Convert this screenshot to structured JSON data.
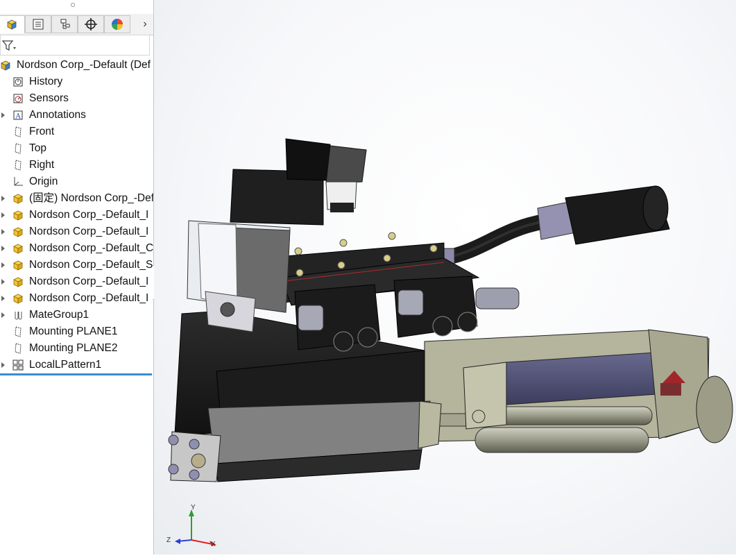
{
  "feature_tree": {
    "tabs": [
      {
        "icon": "featuremanager-icon"
      },
      {
        "icon": "propertymanager-icon"
      },
      {
        "icon": "configurationmanager-icon"
      },
      {
        "icon": "dimxpert-icon"
      },
      {
        "icon": "display-manager-icon"
      }
    ],
    "items": [
      {
        "label": "Nordson Corp_-Default (Def",
        "icon": "assembly-icon",
        "arrow": false
      },
      {
        "label": "History",
        "icon": "history-icon",
        "arrow": false
      },
      {
        "label": "Sensors",
        "icon": "sensors-icon",
        "arrow": false
      },
      {
        "label": "Annotations",
        "icon": "annotations-icon",
        "arrow": true
      },
      {
        "label": "Front",
        "icon": "plane-icon",
        "arrow": false
      },
      {
        "label": "Top",
        "icon": "plane-icon",
        "arrow": false
      },
      {
        "label": "Right",
        "icon": "plane-icon",
        "arrow": false
      },
      {
        "label": "Origin",
        "icon": "origin-icon",
        "arrow": false
      },
      {
        "label": "(固定) Nordson Corp_-Def",
        "icon": "part-icon",
        "arrow": true
      },
      {
        "label": "Nordson Corp_-Default_I",
        "icon": "part-icon",
        "arrow": true
      },
      {
        "label": "Nordson Corp_-Default_I",
        "icon": "part-icon",
        "arrow": true
      },
      {
        "label": "Nordson Corp_-Default_C",
        "icon": "part-icon",
        "arrow": true
      },
      {
        "label": "Nordson Corp_-Default_S",
        "icon": "part-icon",
        "arrow": true
      },
      {
        "label": "Nordson Corp_-Default_I",
        "icon": "part-icon",
        "arrow": true
      },
      {
        "label": "Nordson Corp_-Default_I",
        "icon": "part-icon",
        "arrow": true
      },
      {
        "label": "MateGroup1",
        "icon": "mates-icon",
        "arrow": true
      },
      {
        "label": "Mounting PLANE1",
        "icon": "plane-icon",
        "arrow": false
      },
      {
        "label": "Mounting PLANE2",
        "icon": "plane-icon",
        "arrow": false
      },
      {
        "label": "LocalLPattern1",
        "icon": "pattern-icon",
        "arrow": true
      }
    ]
  },
  "triad": {
    "x": "X",
    "y": "Y",
    "z": "Z"
  },
  "colors": {
    "accent": "#3a8ccf",
    "part_yellow": "#f2c230",
    "body_black": "#1e1e1e",
    "beige": "#b9b8a0"
  }
}
